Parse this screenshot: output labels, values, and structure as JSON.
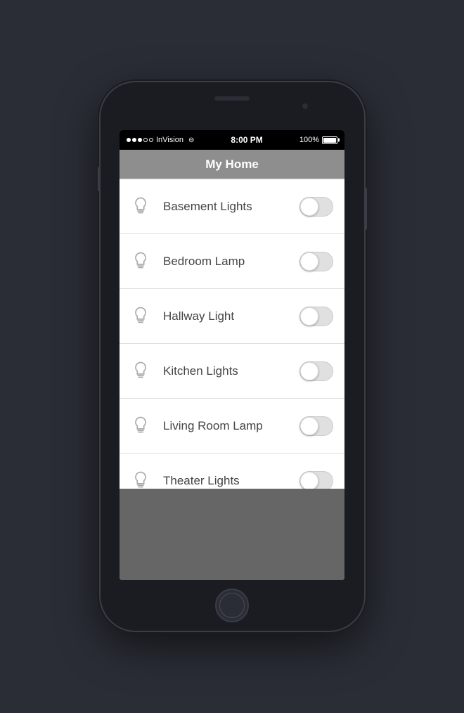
{
  "phone": {
    "status_bar": {
      "carrier": "InVision",
      "time": "8:00 PM",
      "battery_percent": "100%"
    },
    "nav": {
      "title": "My Home"
    },
    "lights": [
      {
        "id": "basement-lights",
        "name": "Basement  Lights",
        "on": false
      },
      {
        "id": "bedroom-lamp",
        "name": "Bedroom Lamp",
        "on": false
      },
      {
        "id": "hallway-light",
        "name": "Hallway Light",
        "on": false
      },
      {
        "id": "kitchen-lights",
        "name": "Kitchen Lights",
        "on": false
      },
      {
        "id": "living-room-lamp",
        "name": "Living Room Lamp",
        "on": false
      },
      {
        "id": "theater-lights",
        "name": "Theater Lights",
        "on": false
      }
    ]
  }
}
